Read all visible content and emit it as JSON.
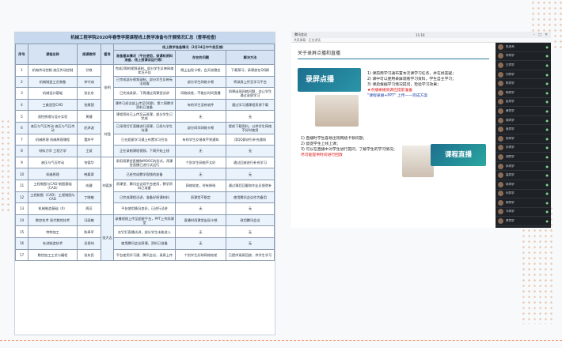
{
  "document": {
    "title": "机械工程学院2020年春季学期课程线上教学准备与开展情况汇总（督导检查）",
    "headers": {
      "no": "序号",
      "course": "课程名称",
      "teacher": "授课教师",
      "group": "督导",
      "section": "线上教学准备情况（2月24日中午前反馈）",
      "basic": "准备基本情况（平台使用，录课和资料准备、线上授课试运行等）",
      "problem": "存在的问题",
      "solution": "解决方法"
    },
    "rows": [
      {
        "no": "1",
        "course": "机电传动控制 液压传动控制",
        "teacher": "孙铁",
        "group": "",
        "basic": "完成2周的视频录制，部分学生反映网络状况不佳",
        "problem": "晚上出现卡顿，白天较稳定",
        "solution": "下载预习，录课放在QQ群"
      },
      {
        "no": "2",
        "course": "机械制造工艺装备",
        "teacher": "李守成",
        "group": "",
        "basic": "已完成部分视频录制，部分学生反映无法观看",
        "problem": "部分学生网络卡顿",
        "solution": "将录屏上传至学习平台"
      },
      {
        "no": "3",
        "course": "机械设计基础",
        "teacher": "张长东",
        "group": "",
        "basic": "已完成录屏，下周通过雨课堂试讲",
        "problem": "网络较差，不能长时间直播",
        "solution": "如果出现网络问题，会让学生通过录屏学习"
      },
      {
        "no": "4",
        "course": "三维造型CAD",
        "teacher": "张建国",
        "group": "",
        "basic": "课件已经全部上传至QQ群，第二周教学资料已准备",
        "problem": "有的学生没有软件",
        "solution": "通过学习通课程资源下载"
      },
      {
        "no": "5",
        "course": "测控原理与设计实验",
        "teacher": "黄健",
        "group": "",
        "basic": "课程资料已上传至云班课，部分学生已完成",
        "problem": "无",
        "solution": "无"
      },
      {
        "no": "6",
        "course": "液压与气压传动 液压与气压传动",
        "teacher": "纪泽波",
        "group": "",
        "basic": "已采用钉钉直播进行授课，已经与学生沟通",
        "problem": "部分同学网络卡顿",
        "solution": "提前下载资料，以供学生网络不好时使用"
      },
      {
        "no": "7",
        "course": "机械原理 机械原理课程",
        "teacher": "董岸平",
        "group": "",
        "basic": "已在超星学习通上布置学习任务",
        "problem": "有的学生反馈收不到通知",
        "solution": "用QQ群进行补充通知"
      },
      {
        "no": "8",
        "course": "材料力学 工程力学",
        "teacher": "王斌",
        "group": "",
        "basic": "正在录制课程视频，下周开始上线",
        "problem": "无",
        "solution": "无"
      },
      {
        "no": "9",
        "course": "液压与气压传动",
        "teacher": "何德华",
        "group": "",
        "basic": "采用雨课堂直播和MOOC的形式，雨课堂直播已进行试运行",
        "problem": "个别学生网络不太好",
        "solution": "通过回放进行补充学习"
      },
      {
        "no": "10",
        "course": "机械原理",
        "teacher": "韩素青",
        "group": "",
        "basic": "已经完成教学视频的准备",
        "problem": "无",
        "solution": "无"
      },
      {
        "no": "11",
        "course": "工程制图与CAD 制图基础（CAD）",
        "teacher": "成健",
        "group": "",
        "basic": "雨课堂、腾讯会议双平台使用，教学资料已准备",
        "problem": "网络较差，时有掉线",
        "solution": "通过课后回看和作业反馈弥补"
      },
      {
        "no": "12",
        "course": "工程制图（CAD） 工程制图与CAD",
        "teacher": "丁晓敏",
        "group": "",
        "basic": "已完成课程试讲，准备好授课材料",
        "problem": "雨课堂不稳定",
        "solution": "使用腾讯会议作为备用"
      },
      {
        "no": "13",
        "course": "机械制造基础（II）",
        "teacher": "周芳",
        "group": "",
        "basic": "平台使用情况良好，已进行试讲",
        "problem": "无",
        "solution": "无"
      },
      {
        "no": "14",
        "course": "数控技术 现代数控技术",
        "teacher": "冯丽敏",
        "group": "",
        "basic": "录播视频上传至超星平台，PPT上传雨课堂",
        "problem": "直播时雨课堂出现卡顿",
        "solution": "改用腾讯会议"
      },
      {
        "no": "15",
        "course": "特种加工",
        "teacher": "陈奉军",
        "group": "",
        "basic": "在钉钉直播试讲，部分学生未能进入",
        "problem": "无",
        "solution": "无"
      },
      {
        "no": "16",
        "course": "先进制造技术",
        "teacher": "吴保伟",
        "group": "",
        "basic": "使用腾讯会议授课，资料已准备",
        "problem": "无",
        "solution": "无"
      },
      {
        "no": "17",
        "course": "数控加工工艺与编程",
        "teacher": "张东民",
        "group": "",
        "basic": "平台使用学习通、腾讯会议，录屏上传",
        "problem": "个别学生反映网络较差",
        "solution": "已提供录屏回放，供学生学习"
      }
    ],
    "groups": [
      {
        "rowStart": 1,
        "label": "张明"
      },
      {
        "rowStart": 5,
        "label": "刘强"
      },
      {
        "rowStart": 9,
        "label": "刘德发"
      },
      {
        "rowStart": 14,
        "label": "张大志"
      }
    ]
  },
  "screen": {
    "app_title": "腾讯会议",
    "clock": "11:16",
    "toolbar": "共享屏幕 · 正在讲话",
    "slide": {
      "heading": "关于录屏点播和直播",
      "rec_label": "录屏点播",
      "live_label": "课程直播",
      "text1": [
        "1) 课前用学习通布置本次课学习任务，并在线答疑；",
        "2) 课中可以使用录屏观看学习资料，学生自主学习；",
        "3) 课后根据学习情况提问，检验学习效果；"
      ],
      "text1_red": "★点播录播资源应提前准备",
      "text1_blue": "\"课程录屏+PPT\" 上传——完成方案",
      "text2": [
        "1) 直播时学生容易出现网络卡顿问题；",
        "2) 督促学生上线上课；",
        "3) 可以在直播中对学生进行提问，了解学生的学习情况；"
      ],
      "text2_red": "尽可能提供时间进行回放"
    },
    "participants": [
      "张老师",
      "李同学",
      "王同学",
      "刘同学",
      "陈同学",
      "杨同学",
      "赵同学",
      "黄同学",
      "周同学",
      "吴同学",
      "徐同学",
      "孙同学",
      "胡同学",
      "朱同学",
      "高同学",
      "林同学",
      "何同学",
      "郭同学",
      "马同学",
      "罗同学"
    ]
  }
}
